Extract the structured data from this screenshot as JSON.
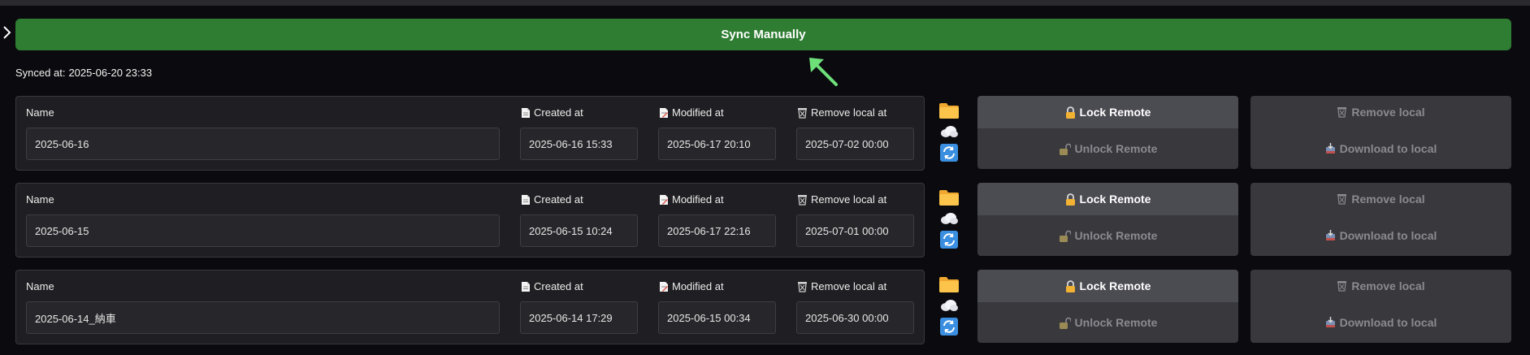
{
  "sync": {
    "button_label": "Sync Manually",
    "synced_label": "Synced at:",
    "synced_value": "2025-06-20 23:33"
  },
  "labels": {
    "name": "Name",
    "created": "Created at",
    "modified": "Modified at",
    "remove_local_at": "Remove local at",
    "lock_remote": "Lock Remote",
    "unlock_remote": "Unlock Remote",
    "remove_local": "Remove local",
    "download_to_local": "Download to local"
  },
  "rows": [
    {
      "name": "2025-06-16",
      "created": "2025-06-16 15:33",
      "modified": "2025-06-17 20:10",
      "remove_at": "2025-07-02 00:00"
    },
    {
      "name": "2025-06-15",
      "created": "2025-06-15 10:24",
      "modified": "2025-06-17 22:16",
      "remove_at": "2025-07-01 00:00"
    },
    {
      "name": "2025-06-14_納車",
      "created": "2025-06-14 17:29",
      "modified": "2025-06-15 00:34",
      "remove_at": "2025-06-30 00:00"
    }
  ],
  "colors": {
    "accent": "#2e7d32",
    "arrow": "#6ee07a",
    "card_bg": "#1f1f23"
  },
  "icons": [
    "expand-chevron-icon",
    "folder-icon",
    "cloud-icon",
    "sync-icon",
    "document-icon",
    "modified-document-icon",
    "wastebasket-icon",
    "lock-icon",
    "unlock-icon",
    "download-icon",
    "arrow-icon"
  ]
}
